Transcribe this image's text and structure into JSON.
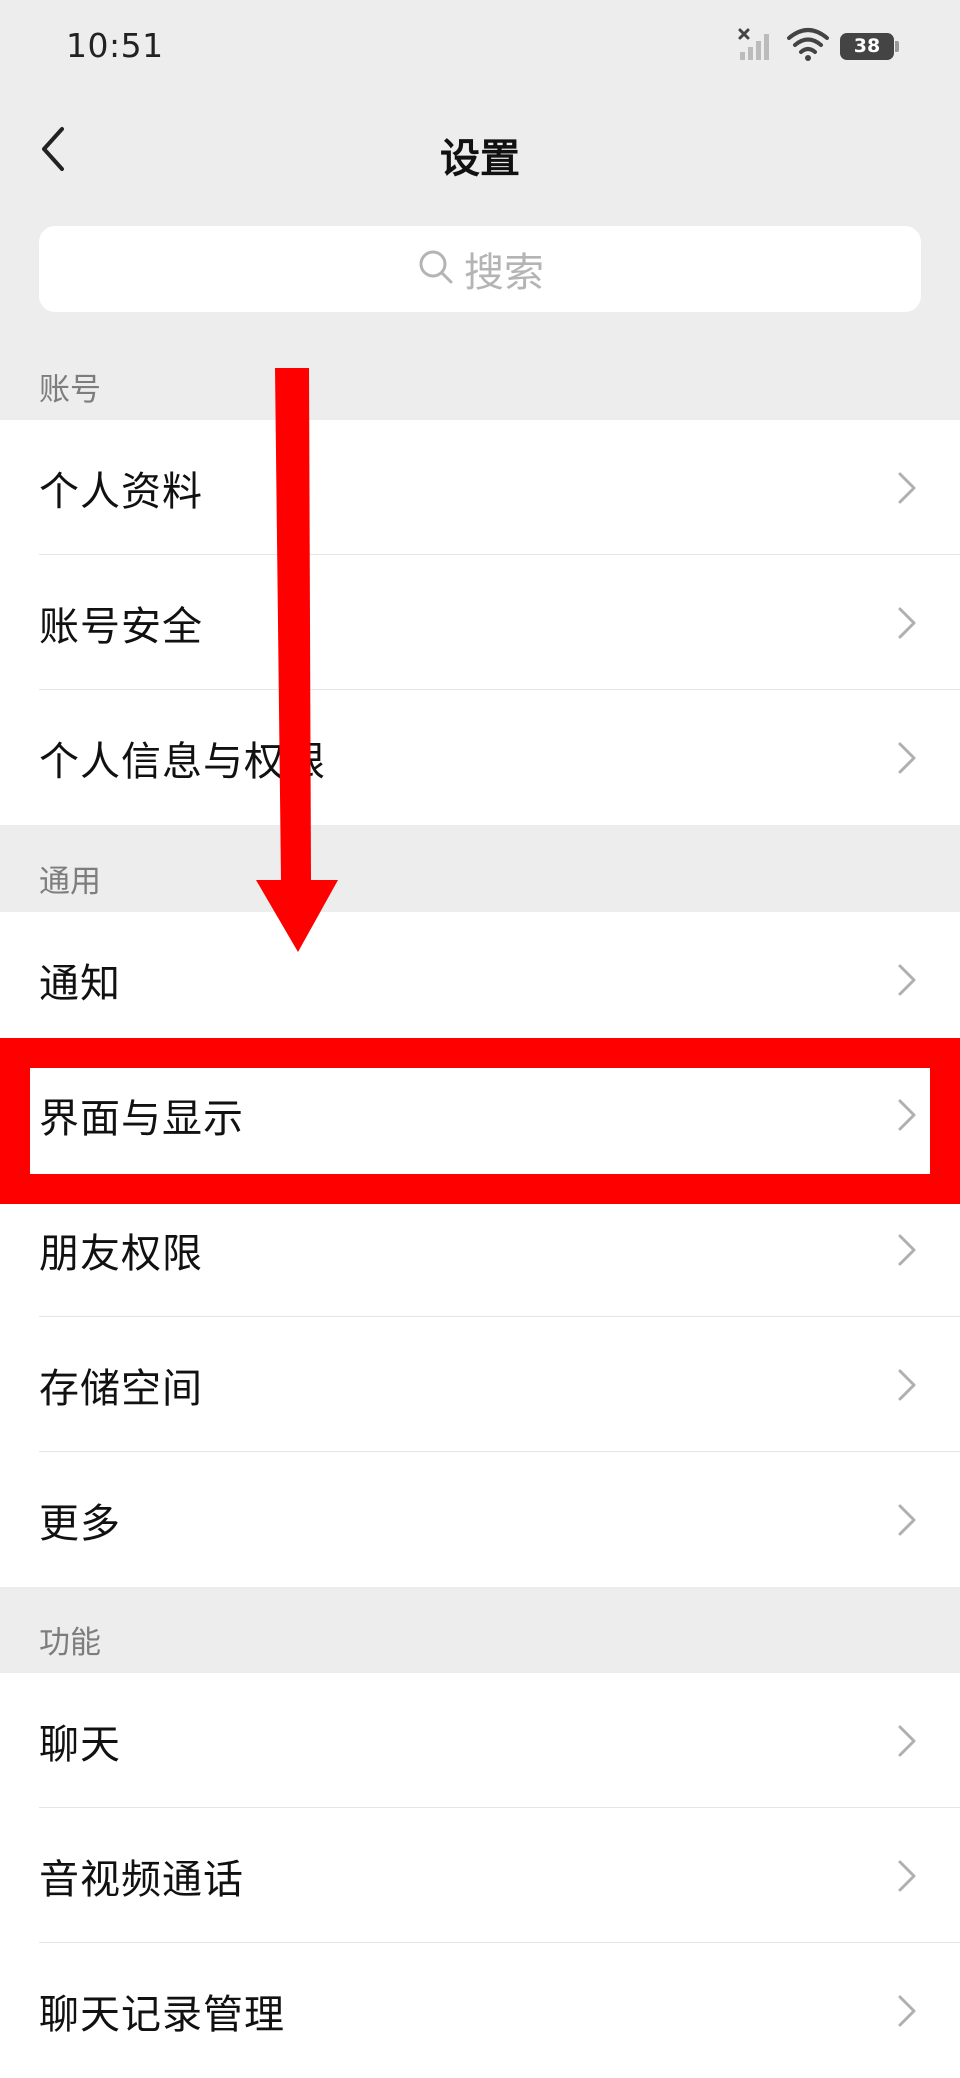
{
  "status_bar": {
    "time": "10:51",
    "battery_level": "38",
    "icons": [
      "signal-off-icon",
      "wifi-icon",
      "battery-icon"
    ]
  },
  "nav": {
    "title": "设置",
    "back_icon": "chevron-left-icon"
  },
  "search": {
    "placeholder": "搜索",
    "icon": "search-icon"
  },
  "sections": [
    {
      "label": "账号",
      "items": [
        {
          "label": "个人资料"
        },
        {
          "label": "账号安全"
        },
        {
          "label": "个人信息与权限"
        }
      ]
    },
    {
      "label": "通用",
      "items": [
        {
          "label": "通知"
        },
        {
          "label": "界面与显示"
        },
        {
          "label": "朋友权限"
        },
        {
          "label": "存储空间"
        },
        {
          "label": "更多"
        }
      ]
    },
    {
      "label": "功能",
      "items": [
        {
          "label": "聊天"
        },
        {
          "label": "音视频通话"
        },
        {
          "label": "聊天记录管理"
        }
      ]
    }
  ],
  "annotation": {
    "highlighted_item": "界面与显示",
    "color": "#ff0000",
    "shapes": [
      "down-arrow",
      "highlight-box"
    ]
  },
  "colors": {
    "background": "#ededed",
    "card": "#ffffff",
    "annotation": "#ff0000",
    "section_label": "#7d7d7d"
  }
}
